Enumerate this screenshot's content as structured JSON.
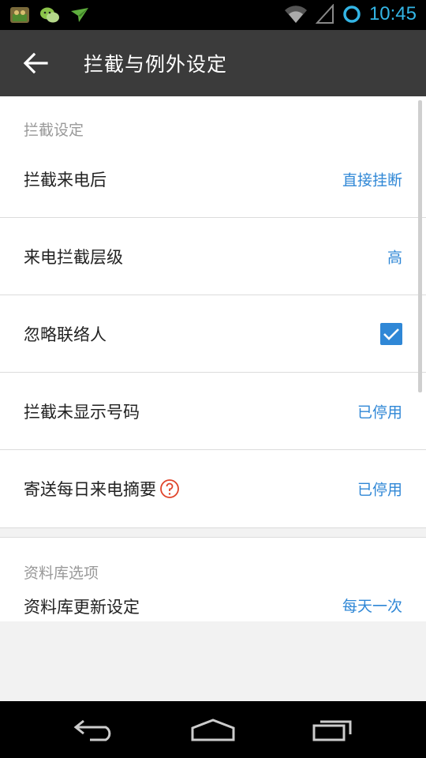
{
  "status_bar": {
    "time": "10:45",
    "icons": [
      "game-app-icon",
      "wechat-icon",
      "paper-plane-icon",
      "wifi-icon",
      "signal-icon",
      "sync-ring-icon"
    ],
    "accent": "#33b5e5"
  },
  "app_bar": {
    "title": "拦截与例外设定",
    "back_icon": "arrow-back-icon"
  },
  "sections": [
    {
      "header": "拦截设定",
      "rows": [
        {
          "label": "拦截来电后",
          "value": "直接挂断"
        },
        {
          "label": "来电拦截层级",
          "value": "高"
        },
        {
          "label": "忽略联络人",
          "checked": true
        },
        {
          "label": "拦截未显示号码",
          "value": "已停用"
        },
        {
          "label": "寄送每日来电摘要",
          "value": "已停用",
          "help_icon": "question-circle-icon"
        }
      ]
    },
    {
      "header": "资料库选项",
      "rows": [
        {
          "label": "资料库更新设定",
          "value": "每天一次"
        }
      ]
    }
  ],
  "nav_bar": {
    "buttons": [
      "back-nav-icon",
      "home-nav-icon",
      "recents-nav-icon"
    ]
  },
  "colors": {
    "value_blue": "#2f87d6",
    "app_bar": "#3b3b3b",
    "help_red": "#e0442a"
  }
}
